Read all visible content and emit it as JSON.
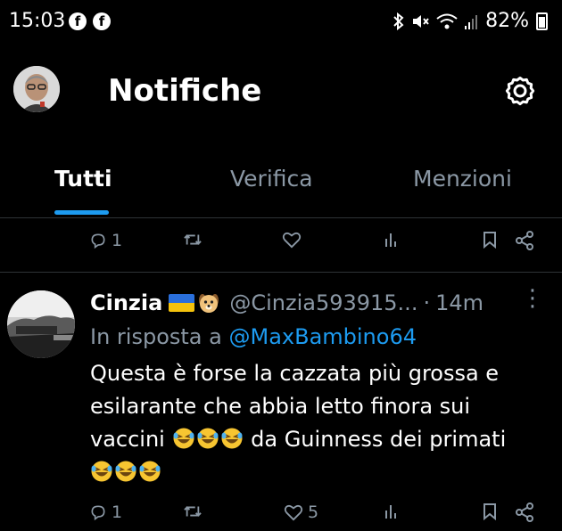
{
  "status_bar": {
    "time": "15:03",
    "battery": "82%",
    "notification_icons": [
      "facebook-icon",
      "facebook-icon"
    ],
    "system_icons": [
      "bluetooth-icon",
      "mute-icon",
      "wifi-icon",
      "signal-icon",
      "battery-icon"
    ]
  },
  "header": {
    "title": "Notifiche"
  },
  "tabs": [
    {
      "label": "Tutti",
      "active": true
    },
    {
      "label": "Verifica",
      "active": false
    },
    {
      "label": "Menzioni",
      "active": false
    }
  ],
  "prev_tweet": {
    "reply_count": "1"
  },
  "tweet": {
    "name": "Cinzia",
    "handle": "@Cinzia593915...",
    "separator": "·",
    "time": "14m",
    "reply_prefix": "In risposta a",
    "reply_to": "@MaxBambino64",
    "text_line1": "Questa è forse la cazzata più grossa e",
    "text_line2": "esilarante che abbia letto finora sui",
    "text_line3a": "vaccini",
    "text_line3b": "da Guinness dei primati",
    "reply_count": "1",
    "like_count": "5"
  },
  "colors": {
    "accent": "#1d9bf0",
    "muted": "#8b98a5",
    "divider": "#2f3336",
    "background": "#000000"
  }
}
